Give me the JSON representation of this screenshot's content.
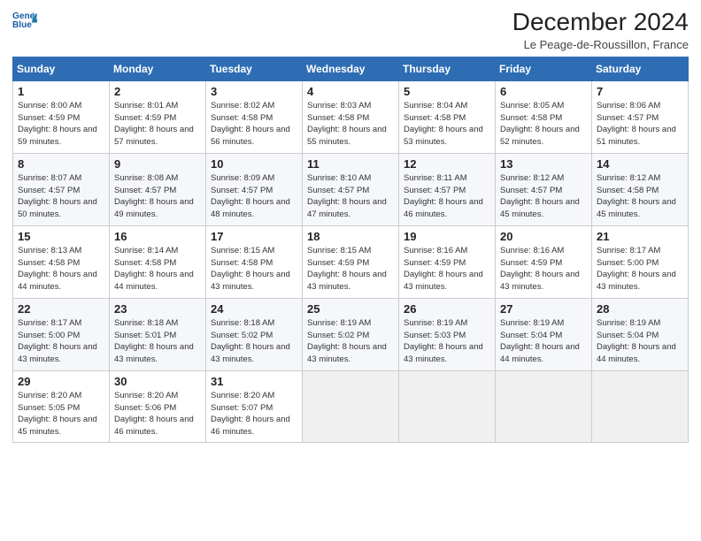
{
  "header": {
    "logo_line1": "General",
    "logo_line2": "Blue",
    "month": "December 2024",
    "location": "Le Peage-de-Roussillon, France"
  },
  "days_of_week": [
    "Sunday",
    "Monday",
    "Tuesday",
    "Wednesday",
    "Thursday",
    "Friday",
    "Saturday"
  ],
  "weeks": [
    [
      {
        "day": 1,
        "sunrise": "8:00 AM",
        "sunset": "4:59 PM",
        "daylight": "8 hours and 59 minutes."
      },
      {
        "day": 2,
        "sunrise": "8:01 AM",
        "sunset": "4:59 PM",
        "daylight": "8 hours and 57 minutes."
      },
      {
        "day": 3,
        "sunrise": "8:02 AM",
        "sunset": "4:58 PM",
        "daylight": "8 hours and 56 minutes."
      },
      {
        "day": 4,
        "sunrise": "8:03 AM",
        "sunset": "4:58 PM",
        "daylight": "8 hours and 55 minutes."
      },
      {
        "day": 5,
        "sunrise": "8:04 AM",
        "sunset": "4:58 PM",
        "daylight": "8 hours and 53 minutes."
      },
      {
        "day": 6,
        "sunrise": "8:05 AM",
        "sunset": "4:58 PM",
        "daylight": "8 hours and 52 minutes."
      },
      {
        "day": 7,
        "sunrise": "8:06 AM",
        "sunset": "4:57 PM",
        "daylight": "8 hours and 51 minutes."
      }
    ],
    [
      {
        "day": 8,
        "sunrise": "8:07 AM",
        "sunset": "4:57 PM",
        "daylight": "8 hours and 50 minutes."
      },
      {
        "day": 9,
        "sunrise": "8:08 AM",
        "sunset": "4:57 PM",
        "daylight": "8 hours and 49 minutes."
      },
      {
        "day": 10,
        "sunrise": "8:09 AM",
        "sunset": "4:57 PM",
        "daylight": "8 hours and 48 minutes."
      },
      {
        "day": 11,
        "sunrise": "8:10 AM",
        "sunset": "4:57 PM",
        "daylight": "8 hours and 47 minutes."
      },
      {
        "day": 12,
        "sunrise": "8:11 AM",
        "sunset": "4:57 PM",
        "daylight": "8 hours and 46 minutes."
      },
      {
        "day": 13,
        "sunrise": "8:12 AM",
        "sunset": "4:57 PM",
        "daylight": "8 hours and 45 minutes."
      },
      {
        "day": 14,
        "sunrise": "8:12 AM",
        "sunset": "4:58 PM",
        "daylight": "8 hours and 45 minutes."
      }
    ],
    [
      {
        "day": 15,
        "sunrise": "8:13 AM",
        "sunset": "4:58 PM",
        "daylight": "8 hours and 44 minutes."
      },
      {
        "day": 16,
        "sunrise": "8:14 AM",
        "sunset": "4:58 PM",
        "daylight": "8 hours and 44 minutes."
      },
      {
        "day": 17,
        "sunrise": "8:15 AM",
        "sunset": "4:58 PM",
        "daylight": "8 hours and 43 minutes."
      },
      {
        "day": 18,
        "sunrise": "8:15 AM",
        "sunset": "4:59 PM",
        "daylight": "8 hours and 43 minutes."
      },
      {
        "day": 19,
        "sunrise": "8:16 AM",
        "sunset": "4:59 PM",
        "daylight": "8 hours and 43 minutes."
      },
      {
        "day": 20,
        "sunrise": "8:16 AM",
        "sunset": "4:59 PM",
        "daylight": "8 hours and 43 minutes."
      },
      {
        "day": 21,
        "sunrise": "8:17 AM",
        "sunset": "5:00 PM",
        "daylight": "8 hours and 43 minutes."
      }
    ],
    [
      {
        "day": 22,
        "sunrise": "8:17 AM",
        "sunset": "5:00 PM",
        "daylight": "8 hours and 43 minutes."
      },
      {
        "day": 23,
        "sunrise": "8:18 AM",
        "sunset": "5:01 PM",
        "daylight": "8 hours and 43 minutes."
      },
      {
        "day": 24,
        "sunrise": "8:18 AM",
        "sunset": "5:02 PM",
        "daylight": "8 hours and 43 minutes."
      },
      {
        "day": 25,
        "sunrise": "8:19 AM",
        "sunset": "5:02 PM",
        "daylight": "8 hours and 43 minutes."
      },
      {
        "day": 26,
        "sunrise": "8:19 AM",
        "sunset": "5:03 PM",
        "daylight": "8 hours and 43 minutes."
      },
      {
        "day": 27,
        "sunrise": "8:19 AM",
        "sunset": "5:04 PM",
        "daylight": "8 hours and 44 minutes."
      },
      {
        "day": 28,
        "sunrise": "8:19 AM",
        "sunset": "5:04 PM",
        "daylight": "8 hours and 44 minutes."
      }
    ],
    [
      {
        "day": 29,
        "sunrise": "8:20 AM",
        "sunset": "5:05 PM",
        "daylight": "8 hours and 45 minutes."
      },
      {
        "day": 30,
        "sunrise": "8:20 AM",
        "sunset": "5:06 PM",
        "daylight": "8 hours and 46 minutes."
      },
      {
        "day": 31,
        "sunrise": "8:20 AM",
        "sunset": "5:07 PM",
        "daylight": "8 hours and 46 minutes."
      },
      null,
      null,
      null,
      null
    ]
  ],
  "labels": {
    "sunrise": "Sunrise:",
    "sunset": "Sunset:",
    "daylight": "Daylight:"
  }
}
